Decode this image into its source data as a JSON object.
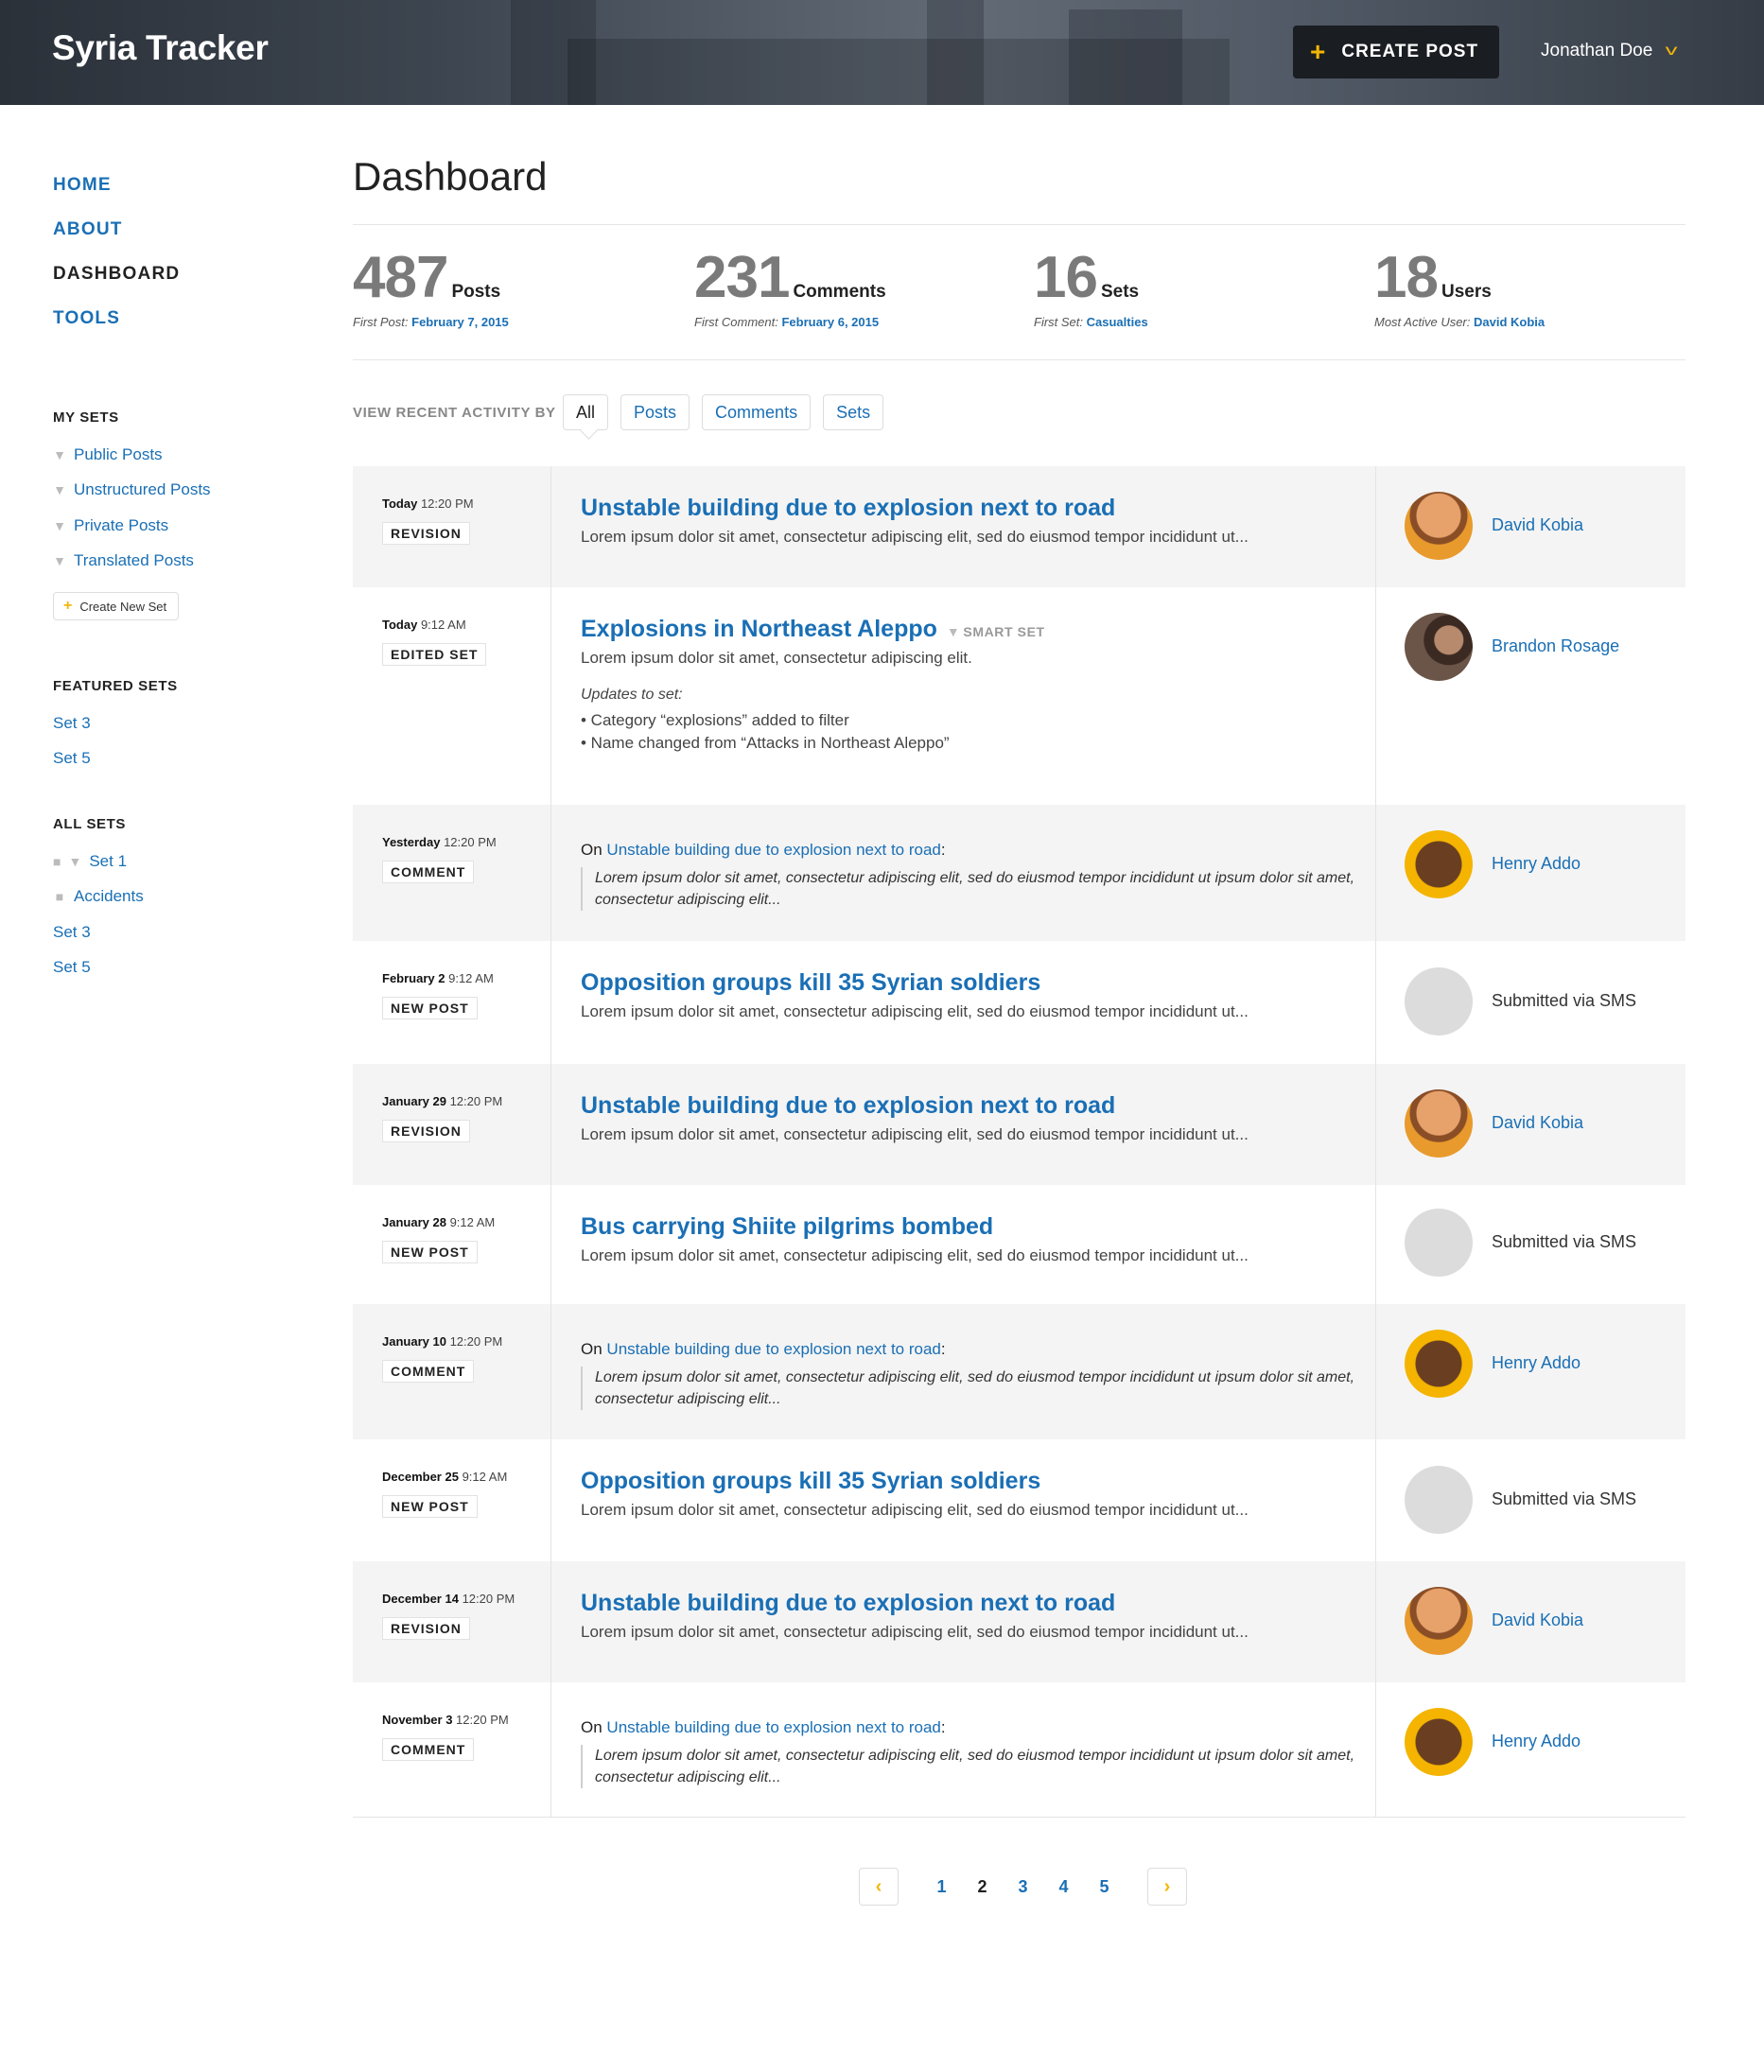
{
  "header": {
    "brand": "Syria Tracker",
    "create_label": "CREATE POST",
    "user_name": "Jonathan Doe"
  },
  "nav": [
    "HOME",
    "ABOUT",
    "DASHBOARD",
    "TOOLS"
  ],
  "nav_active": "DASHBOARD",
  "my_sets": {
    "title": "MY SETS",
    "items": [
      "Public Posts",
      "Unstructured Posts",
      "Private Posts",
      "Translated Posts"
    ],
    "create_label": "Create New Set"
  },
  "featured_sets": {
    "title": "FEATURED SETS",
    "items": [
      "Set 3",
      "Set 5"
    ]
  },
  "all_sets": {
    "title": "ALL SETS",
    "items": [
      "Set 1",
      "Accidents",
      "Set 3",
      "Set 5"
    ]
  },
  "page_title": "Dashboard",
  "stats": [
    {
      "num": "487",
      "label": "Posts",
      "sub": "First Post:",
      "link": "February 7, 2015"
    },
    {
      "num": "231",
      "label": "Comments",
      "sub": "First Comment:",
      "link": "February 6, 2015"
    },
    {
      "num": "16",
      "label": "Sets",
      "sub": "First Set:",
      "link": "Casualties"
    },
    {
      "num": "18",
      "label": "Users",
      "sub": "Most Active User:",
      "link": "David Kobia"
    }
  ],
  "filter": {
    "label": "VIEW RECENT ACTIVITY BY",
    "options": [
      "All",
      "Posts",
      "Comments",
      "Sets"
    ]
  },
  "activity": [
    {
      "day": "Today",
      "time": "12:20 PM",
      "badge": "REVISION",
      "title": "Unstable building due to explosion next to road",
      "excerpt": "Lorem ipsum dolor sit amet, consectetur adipiscing elit, sed do eiusmod tempor incididunt ut...",
      "user": "David Kobia"
    },
    {
      "day": "Today",
      "time": "9:12 AM",
      "badge": "EDITED SET",
      "title": "Explosions in Northeast Aleppo",
      "smart": "SMART SET",
      "excerpt": "Lorem ipsum dolor sit amet, consectetur adipiscing elit.",
      "updates_label": "Updates to set:",
      "bullets": [
        "• Category “explosions” added to filter",
        "• Name changed from “Attacks in Northeast Aleppo”"
      ],
      "user": "Brandon Rosage"
    },
    {
      "day": "Yesterday",
      "time": "12:20 PM",
      "badge": "COMMENT",
      "on": "On",
      "link": "Unstable building due to explosion next to road",
      "quote": "Lorem ipsum dolor sit amet, consectetur adipiscing elit, sed do eiusmod tempor incididunt ut  ipsum dolor sit amet, consectetur adipiscing elit...",
      "user": "Henry Addo"
    },
    {
      "day": "February 2",
      "time": " 9:12 AM",
      "badge": "NEW POST",
      "title": "Opposition groups kill 35 Syrian soldiers",
      "excerpt": "Lorem ipsum dolor sit amet, consectetur adipiscing elit, sed do eiusmod tempor incididunt ut...",
      "user": "Submitted via SMS"
    },
    {
      "day": "January 29",
      "time": "12:20 PM",
      "badge": "REVISION",
      "title": "Unstable building due to explosion next to road",
      "excerpt": "Lorem ipsum dolor sit amet, consectetur adipiscing elit, sed do eiusmod tempor incididunt ut...",
      "user": "David Kobia"
    },
    {
      "day": "January 28",
      "time": "9:12 AM",
      "badge": "NEW POST",
      "title": "Bus carrying Shiite pilgrims bombed",
      "excerpt": "Lorem ipsum dolor sit amet, consectetur adipiscing elit, sed do eiusmod tempor incididunt ut...",
      "user": "Submitted via SMS"
    },
    {
      "day": "January 10",
      "time": "12:20 PM",
      "badge": "COMMENT",
      "on": "On",
      "link": "Unstable building due to explosion next to road",
      "quote": "Lorem ipsum dolor sit amet, consectetur adipiscing elit, sed do eiusmod tempor incididunt ut  ipsum dolor sit amet, consectetur adipiscing elit...",
      "user": "Henry Addo"
    },
    {
      "day": "December 25",
      "time": "9:12 AM",
      "badge": "NEW POST",
      "title": "Opposition groups kill 35 Syrian soldiers",
      "excerpt": "Lorem ipsum dolor sit amet, consectetur adipiscing elit, sed do eiusmod tempor incididunt ut...",
      "user": "Submitted via SMS"
    },
    {
      "day": "December 14",
      "time": "12:20 PM",
      "badge": "REVISION",
      "title": "Unstable building due to explosion next to road",
      "excerpt": "Lorem ipsum dolor sit amet, consectetur adipiscing elit, sed do eiusmod tempor incididunt ut...",
      "user": "David Kobia"
    },
    {
      "day": "November 3",
      "time": "12:20 PM",
      "badge": "COMMENT",
      "on": "On",
      "link": "Unstable building due to explosion next to road",
      "quote": "Lorem ipsum dolor sit amet, consectetur adipiscing elit, sed do eiusmod tempor incididunt ut  ipsum dolor sit amet, consectetur adipiscing elit...",
      "user": "Henry Addo"
    }
  ],
  "pagination": {
    "pages": [
      "1",
      "2",
      "3",
      "4",
      "5"
    ],
    "current": "2"
  }
}
